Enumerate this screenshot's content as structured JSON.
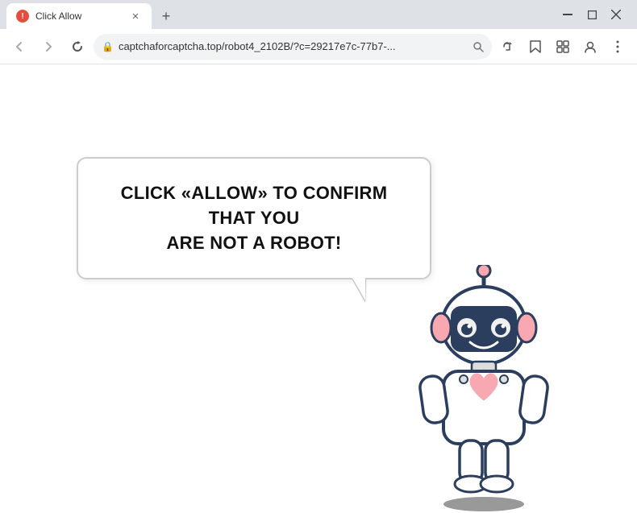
{
  "window": {
    "title": "Click Allow",
    "url": "captchaforcaptcha.top/robot4_2102B/?c=29217e7c-77b7-...",
    "favicon_text": "!",
    "tab_label": "Click Allow"
  },
  "toolbar": {
    "back_label": "←",
    "forward_label": "→",
    "reload_label": "✕",
    "new_tab_label": "+",
    "minimize_label": "─",
    "maximize_label": "□",
    "close_label": "✕",
    "search_icon": "🔍",
    "share_icon": "⎋",
    "bookmark_icon": "☆",
    "extensions_icon": "⊞",
    "profile_icon": "👤",
    "menu_icon": "⋮"
  },
  "page": {
    "bubble_text_line1": "CLICK «ALLOW» TO CONFIRM THAT YOU",
    "bubble_text_line2": "ARE NOT A ROBOT!"
  }
}
